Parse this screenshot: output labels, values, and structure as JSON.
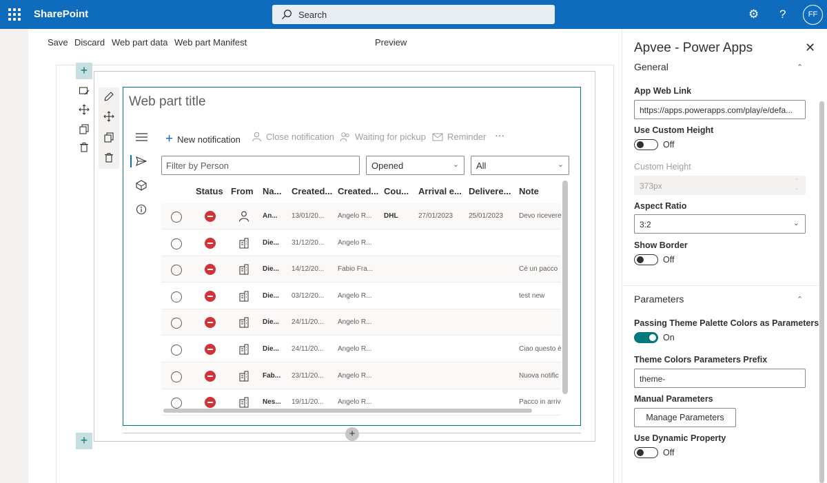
{
  "suitebar": {
    "brand": "SharePoint",
    "search_placeholder": "Search",
    "avatar_initials": "FF",
    "settings_glyph": "⚙",
    "help_glyph": "?"
  },
  "commandbar": {
    "save": "Save",
    "discard": "Discard",
    "web_part_data": "Web part data",
    "web_part_manifest": "Web part Manifest",
    "preview": "Preview"
  },
  "webpart": {
    "title": "Web part title",
    "actions": {
      "new_notification": "New notification",
      "close_notification": "Close notification",
      "waiting_for_pickup": "Waiting for pickup",
      "reminder": "Reminder",
      "more": "···"
    },
    "filter": {
      "person_placeholder": "Filter by Person",
      "status_value": "Opened",
      "scope_value": "All"
    },
    "columns": [
      "Status",
      "From",
      "Na...",
      "Created...",
      "Created...",
      "Cou...",
      "Arrival e...",
      "Delivere...",
      "Note"
    ],
    "rows": [
      {
        "name": "An...",
        "created": "13/01/20...",
        "created_by": "Angelo R...",
        "courier": "DHL",
        "arrival": "27/01/2023",
        "delivered": "25/01/2023",
        "note": "Devo ricevere",
        "from": "person"
      },
      {
        "name": "Die...",
        "created": "31/12/20...",
        "created_by": "Angelo R...",
        "courier": "",
        "arrival": "",
        "delivered": "",
        "note": "",
        "from": "building"
      },
      {
        "name": "Die...",
        "created": "14/12/20...",
        "created_by": "Fabio Fra...",
        "courier": "",
        "arrival": "",
        "delivered": "",
        "note": "Cé un pacco",
        "from": "building"
      },
      {
        "name": "Die...",
        "created": "03/12/20...",
        "created_by": "Angelo R...",
        "courier": "",
        "arrival": "",
        "delivered": "",
        "note": "test new",
        "from": "building"
      },
      {
        "name": "Die...",
        "created": "24/11/20...",
        "created_by": "Angelo R...",
        "courier": "",
        "arrival": "",
        "delivered": "",
        "note": "",
        "from": "building"
      },
      {
        "name": "Die...",
        "created": "24/11/20...",
        "created_by": "Angelo R...",
        "courier": "",
        "arrival": "",
        "delivered": "",
        "note": "Ciao questo è",
        "from": "building"
      },
      {
        "name": "Fab...",
        "created": "23/11/20...",
        "created_by": "Angelo R...",
        "courier": "",
        "arrival": "",
        "delivered": "",
        "note": "Nuova notific",
        "from": "building"
      },
      {
        "name": "Nes...",
        "created": "19/11/20...",
        "created_by": "Angelo R...",
        "courier": "",
        "arrival": "",
        "delivered": "",
        "note": "Pacco in arriv",
        "from": "building"
      }
    ]
  },
  "pane": {
    "title": "Apvee - Power Apps",
    "general_group": "General",
    "app_web_link_label": "App Web Link",
    "app_web_link_value": "https://apps.powerapps.com/play/e/defa...",
    "use_custom_height_label": "Use Custom Height",
    "use_custom_height_state": "Off",
    "custom_height_label": "Custom Height",
    "custom_height_value": "373px",
    "aspect_ratio_label": "Aspect Ratio",
    "aspect_ratio_value": "3:2",
    "show_border_label": "Show Border",
    "show_border_state": "Off",
    "parameters_group": "Parameters",
    "passing_theme_label": "Passing Theme Palette Colors as Parameters",
    "passing_theme_state": "On",
    "theme_prefix_label": "Theme Colors Parameters Prefix",
    "theme_prefix_value": "theme-",
    "manual_params_label": "Manual Parameters",
    "manage_params_button": "Manage Parameters",
    "dynamic_property_label": "Use Dynamic Property",
    "dynamic_property_state": "Off"
  },
  "colors": {
    "suitebar": "#0f6cbd",
    "accent": "#03787c",
    "status_red": "#d13438"
  }
}
